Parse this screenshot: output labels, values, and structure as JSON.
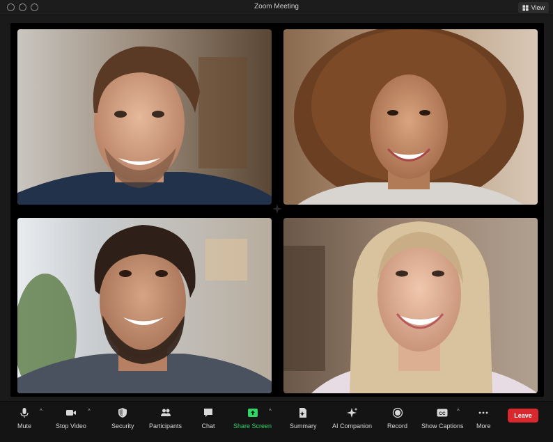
{
  "window": {
    "title": "Zoom Meeting",
    "view_label": "View"
  },
  "toolbar": {
    "mute": "Mute",
    "stop_video": "Stop Video",
    "security": "Security",
    "participants": "Participants",
    "chat": "Chat",
    "share_screen": "Share Screen",
    "summary": "Summary",
    "ai_companion": "AI Companion",
    "record": "Record",
    "show_captions": "Show Captions",
    "more": "More",
    "leave": "Leave",
    "caret": "^",
    "cc_glyph": "CC"
  },
  "colors": {
    "share_green": "#2fd567",
    "leave_red": "#d9292e",
    "stage_black": "#000000",
    "toolbar_bg": "#141414"
  },
  "icons": [
    "microphone-icon",
    "video-camera-icon",
    "shield-icon",
    "participants-icon",
    "chat-bubble-icon",
    "share-screen-icon",
    "summary-icon",
    "ai-sparkle-icon",
    "record-icon",
    "captions-icon",
    "more-dots-icon",
    "grid-view-icon"
  ]
}
